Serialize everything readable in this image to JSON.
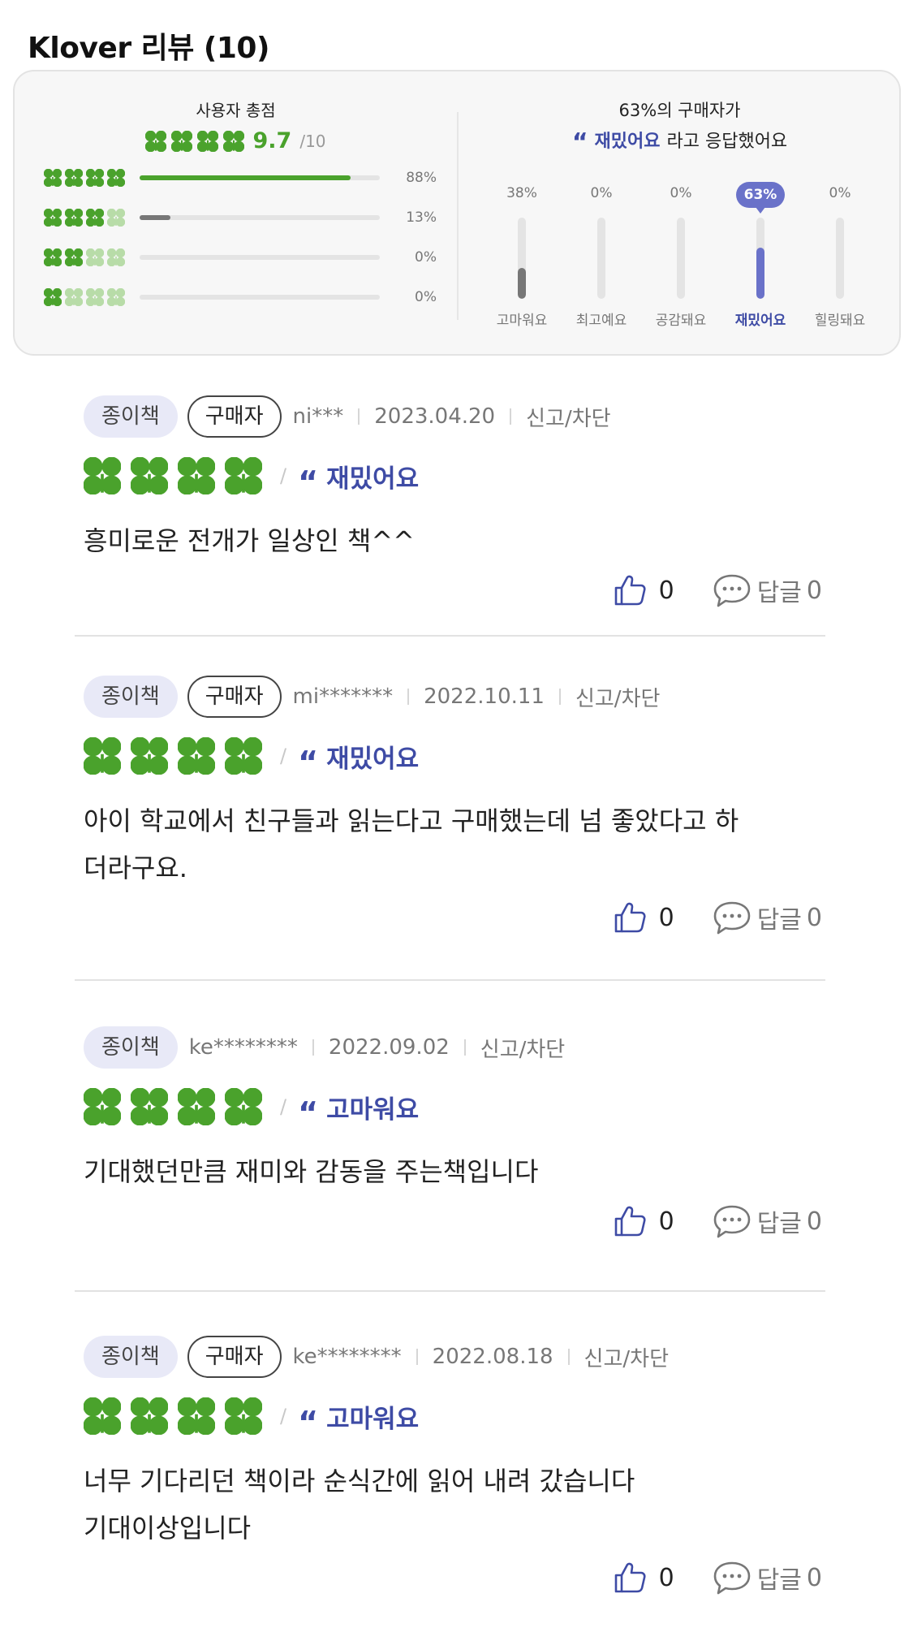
{
  "header": {
    "title": "Klover 리뷰 (10)"
  },
  "summary": {
    "score_title": "사용자 총점",
    "score_value": "9.7",
    "score_max": "/10",
    "distribution": [
      {
        "filled": 4,
        "percent_label": "88%",
        "fill_fraction": 0.88,
        "color": "#4aa22c"
      },
      {
        "filled": 3,
        "percent_label": "13%",
        "fill_fraction": 0.13,
        "color": "#777777"
      },
      {
        "filled": 2,
        "percent_label": "0%",
        "fill_fraction": 0,
        "color": "#777777"
      },
      {
        "filled": 1,
        "percent_label": "0%",
        "fill_fraction": 0,
        "color": "#777777"
      }
    ],
    "emotion_title_line1": "63%의 구매자가",
    "emotion_title_quote": "“",
    "emotion_title_name": "재밌어요",
    "emotion_title_rest": "라고 응답했어요",
    "emotions": [
      {
        "label": "고마워요",
        "percent_label": "38%",
        "fill_fraction": 0.38,
        "active": false
      },
      {
        "label": "최고예요",
        "percent_label": "0%",
        "fill_fraction": 0,
        "active": false
      },
      {
        "label": "공감돼요",
        "percent_label": "0%",
        "fill_fraction": 0,
        "active": false
      },
      {
        "label": "재밌어요",
        "percent_label": "63%",
        "fill_fraction": 0.63,
        "active": true
      },
      {
        "label": "힐링돼요",
        "percent_label": "0%",
        "fill_fraction": 0,
        "active": false
      }
    ]
  },
  "colors": {
    "clover_green": "#4aa22c",
    "clover_light": "#b8dca8",
    "accent_blue": "#3e4ba5",
    "active_badge": "#6a72c9",
    "inactive_bar": "#777777"
  },
  "reviews": [
    {
      "format": "종이책",
      "buyer": "구매자",
      "user": "ni***",
      "date": "2023.04.20",
      "report": "신고/차단",
      "emotion": "재밌어요",
      "text": "흥미로운 전개가 일상인 책^^",
      "likes": "0",
      "reply_label": "답글",
      "reply_count": "0"
    },
    {
      "format": "종이책",
      "buyer": "구매자",
      "user": "mi*******",
      "date": "2022.10.11",
      "report": "신고/차단",
      "emotion": "재밌어요",
      "text": "아이 학교에서 친구들과 읽는다고 구매했는데 넘 좋았다고 하\n더라구요.",
      "likes": "0",
      "reply_label": "답글",
      "reply_count": "0"
    },
    {
      "format": "종이책",
      "buyer": "",
      "user": "ke********",
      "date": "2022.09.02",
      "report": "신고/차단",
      "emotion": "고마워요",
      "text": "기대했던만큼 재미와 감동을 주는책입니다",
      "likes": "0",
      "reply_label": "답글",
      "reply_count": "0"
    },
    {
      "format": "종이책",
      "buyer": "구매자",
      "user": "ke********",
      "date": "2022.08.18",
      "report": "신고/차단",
      "emotion": "고마워요",
      "text": "너무 기다리던 책이라 순식간에 읽어 내려 갔습니다\n기대이상입니다",
      "likes": "0",
      "reply_label": "답글",
      "reply_count": "0"
    }
  ]
}
